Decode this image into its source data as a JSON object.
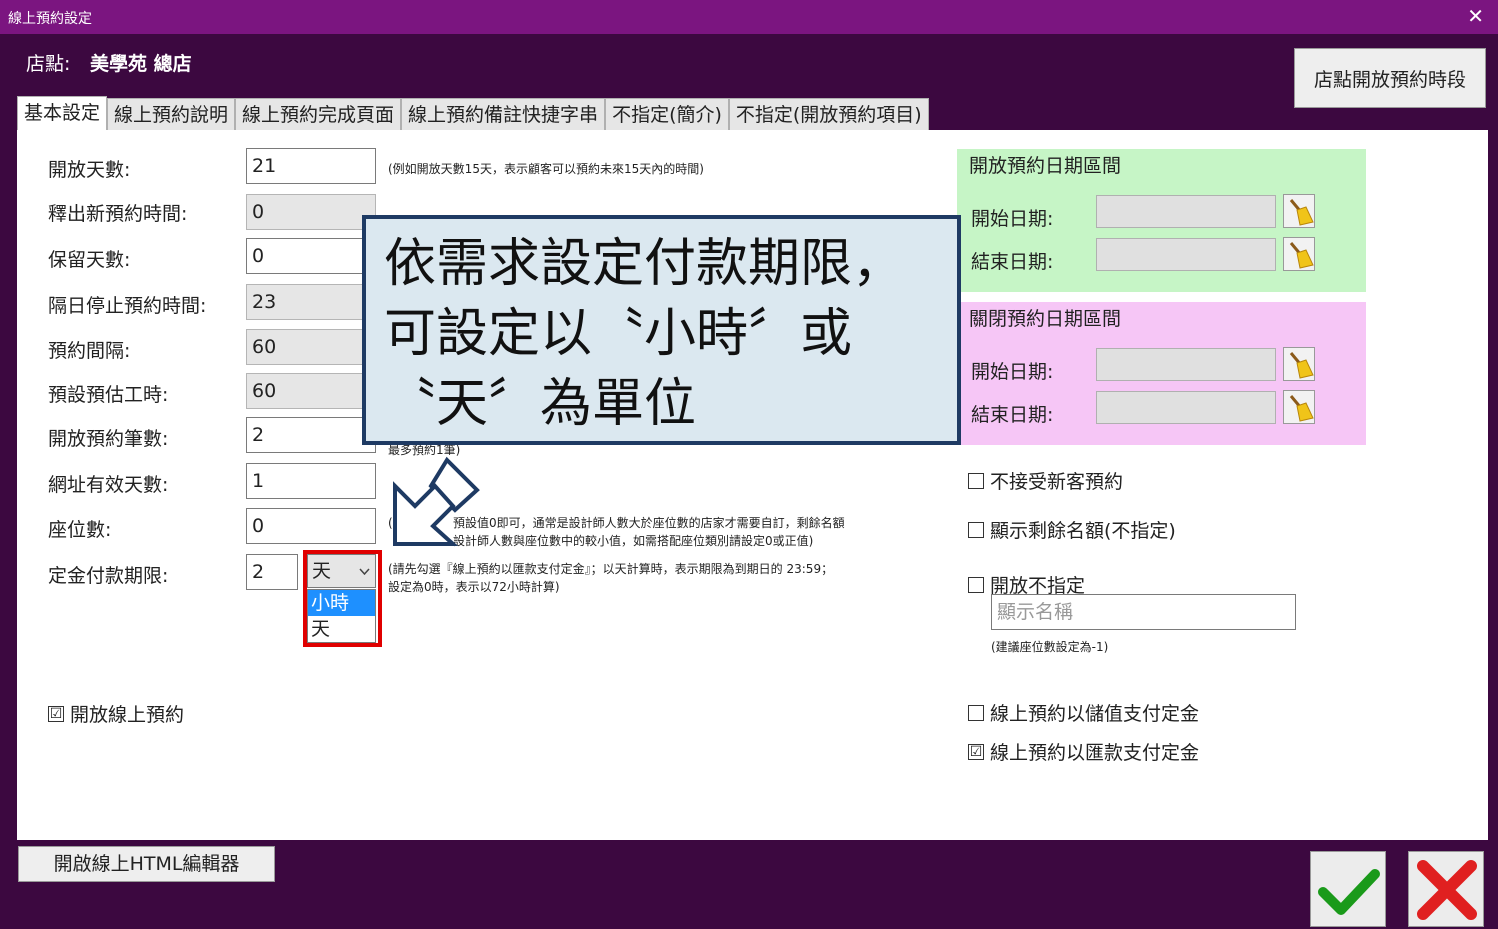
{
  "window": {
    "title": "線上預約設定",
    "close_glyph": "✕"
  },
  "store": {
    "label": "店點:",
    "name": "美學苑 總店"
  },
  "slots_button": "店點開放預約時段",
  "tabs": [
    {
      "label": "基本設定"
    },
    {
      "label": "線上預約說明"
    },
    {
      "label": "線上預約完成頁面"
    },
    {
      "label": "線上預約備註快捷字串"
    },
    {
      "label": "不指定(簡介)"
    },
    {
      "label": "不指定(開放預約項目)"
    }
  ],
  "form": {
    "open_days": {
      "label": "開放天數:",
      "value": "21",
      "hint": "(例如開放天數15天，表示顧客可以預約未來15天內的時間)"
    },
    "release_time": {
      "label": "釋出新預約時間:",
      "value": "0"
    },
    "reserve_days": {
      "label": "保留天數:",
      "value": "0"
    },
    "next_day_stop": {
      "label": "隔日停止預約時間:",
      "value": "23"
    },
    "interval": {
      "label": "預約間隔:",
      "value": "60"
    },
    "est_work": {
      "label": "預設預估工時:",
      "value": "60"
    },
    "max_bookings": {
      "label": "開放預約筆數:",
      "value": "2",
      "hint": "最多預約1筆)"
    },
    "url_valid_days": {
      "label": "網址有效天數:",
      "value": "1"
    },
    "seats": {
      "label": "座位數:",
      "value": "0",
      "hint_line1": "(",
      "hint_line1b": "預設值0即可，通常是設計師人數大於座位數的店家才需要自訂，剩餘名額",
      "hint_line2": "設計師人數與座位數中的較小值，如需搭配座位類別請設定0或正值)"
    },
    "deposit_deadline": {
      "label": "定金付款期限:",
      "value": "2",
      "unit": "天",
      "options": [
        "小時",
        "天"
      ],
      "hint_line1": "(請先勾選『線上預約以匯款支付定金』；以天計算時，表示期限為到期日的 23:59；",
      "hint_line2": "設定為0時，表示以72小時計算)"
    },
    "enable_online": {
      "label": "開放線上預約",
      "checked": "☑"
    }
  },
  "open_range": {
    "title": "開放預約日期區間",
    "start_label": "開始日期:",
    "end_label": "結束日期:"
  },
  "close_range": {
    "title": "關閉預約日期區間",
    "start_label": "開始日期:",
    "end_label": "結束日期:"
  },
  "options": {
    "no_new_clients": {
      "label": "不接受新客預約",
      "checked": ""
    },
    "show_remaining": {
      "label": "顯示剩餘名額(不指定)",
      "checked": ""
    },
    "open_unassigned": {
      "label": "開放不指定",
      "checked": "",
      "placeholder": "顯示名稱",
      "hint": "(建議座位數設定為-1)"
    },
    "pay_by_stored_value": {
      "label": "線上預約以儲值支付定金",
      "checked": ""
    },
    "pay_by_transfer": {
      "label": "線上預約以匯款支付定金",
      "checked": "☑"
    }
  },
  "callout": {
    "text": "依需求設定付款期限，\n可設定以〝小時〞或\n〝天〞為單位"
  },
  "footer": {
    "html_editor_button": "開啟線上HTML編輯器"
  },
  "colors": {
    "titlebar": "#7b1580",
    "background": "#3c0840",
    "open_range": "#c6f5c6",
    "close_range": "#f6c6f6",
    "highlight_border": "#e00000",
    "callout_border": "#1e3a63"
  }
}
